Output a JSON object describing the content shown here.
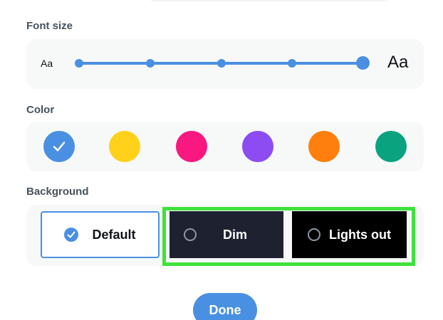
{
  "font_size": {
    "label": "Font size",
    "small_sample": "Aa",
    "large_sample": "Aa",
    "steps": 5,
    "selected_step": 5
  },
  "color": {
    "label": "Color",
    "swatches": [
      {
        "name": "blue",
        "hex": "#4a90e2",
        "selected": true
      },
      {
        "name": "yellow",
        "hex": "#ffd11a",
        "selected": false
      },
      {
        "name": "pink",
        "hex": "#f91880",
        "selected": false
      },
      {
        "name": "purple",
        "hex": "#8c4cf2",
        "selected": false
      },
      {
        "name": "orange",
        "hex": "#ff7f0e",
        "selected": false
      },
      {
        "name": "green",
        "hex": "#0aa37f",
        "selected": false
      }
    ]
  },
  "background": {
    "label": "Background",
    "options": [
      {
        "label": "Default",
        "selected": true
      },
      {
        "label": "Dim",
        "selected": false
      },
      {
        "label": "Lights out",
        "selected": false
      }
    ],
    "highlight_color": "#3fe23a"
  },
  "done_button": {
    "label": "Done"
  },
  "colors": {
    "accent": "#4a90e2",
    "panel_bg": "#f7f9f9",
    "dim_bg": "#1e2230",
    "lights_out_bg": "#000000"
  }
}
